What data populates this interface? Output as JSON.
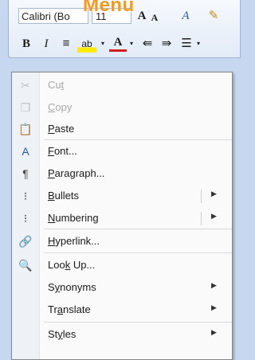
{
  "overlay": {
    "title": "Menu"
  },
  "toolbar": {
    "font": "Calibri (Bo",
    "size": "11",
    "grow": "A",
    "shrink": "A",
    "styles_icon": "A",
    "bold": "B",
    "italic": "I",
    "center": "≡",
    "highlight": "ab",
    "font_color": "A",
    "outdent": "⇚",
    "indent": "⇛",
    "bullets": "☰"
  },
  "menu": {
    "items": [
      {
        "pre": "Cu",
        "u": "t",
        "post": "",
        "icon": "✂",
        "disabled": true
      },
      {
        "pre": "",
        "u": "C",
        "post": "opy",
        "icon": "❐",
        "disabled": true
      },
      {
        "pre": "",
        "u": "P",
        "post": "aste",
        "icon": "📋",
        "disabled": false
      },
      {
        "pre": "",
        "u": "F",
        "post": "ont...",
        "icon": "A",
        "disabled": false
      },
      {
        "pre": "",
        "u": "P",
        "post": "aragraph...",
        "icon": "¶",
        "disabled": false
      },
      {
        "pre": "",
        "u": "B",
        "post": "ullets",
        "icon": "⁝",
        "disabled": false,
        "submenu": true
      },
      {
        "pre": "",
        "u": "N",
        "post": "umbering",
        "icon": "⁝",
        "disabled": false,
        "submenu": true
      },
      {
        "pre": "",
        "u": "H",
        "post": "yperlink...",
        "icon": "🔗",
        "disabled": false
      },
      {
        "pre": "Loo",
        "u": "k",
        "post": " Up...",
        "icon": "🔍",
        "disabled": false
      },
      {
        "pre": "S",
        "u": "y",
        "post": "nonyms",
        "icon": "",
        "disabled": false,
        "submenu": true
      },
      {
        "pre": "Tr",
        "u": "a",
        "post": "nslate",
        "icon": "",
        "disabled": false,
        "submenu": true
      },
      {
        "pre": "St",
        "u": "y",
        "post": "les",
        "icon": "",
        "disabled": false,
        "submenu": true
      }
    ],
    "submenu_arrow": "▶"
  }
}
